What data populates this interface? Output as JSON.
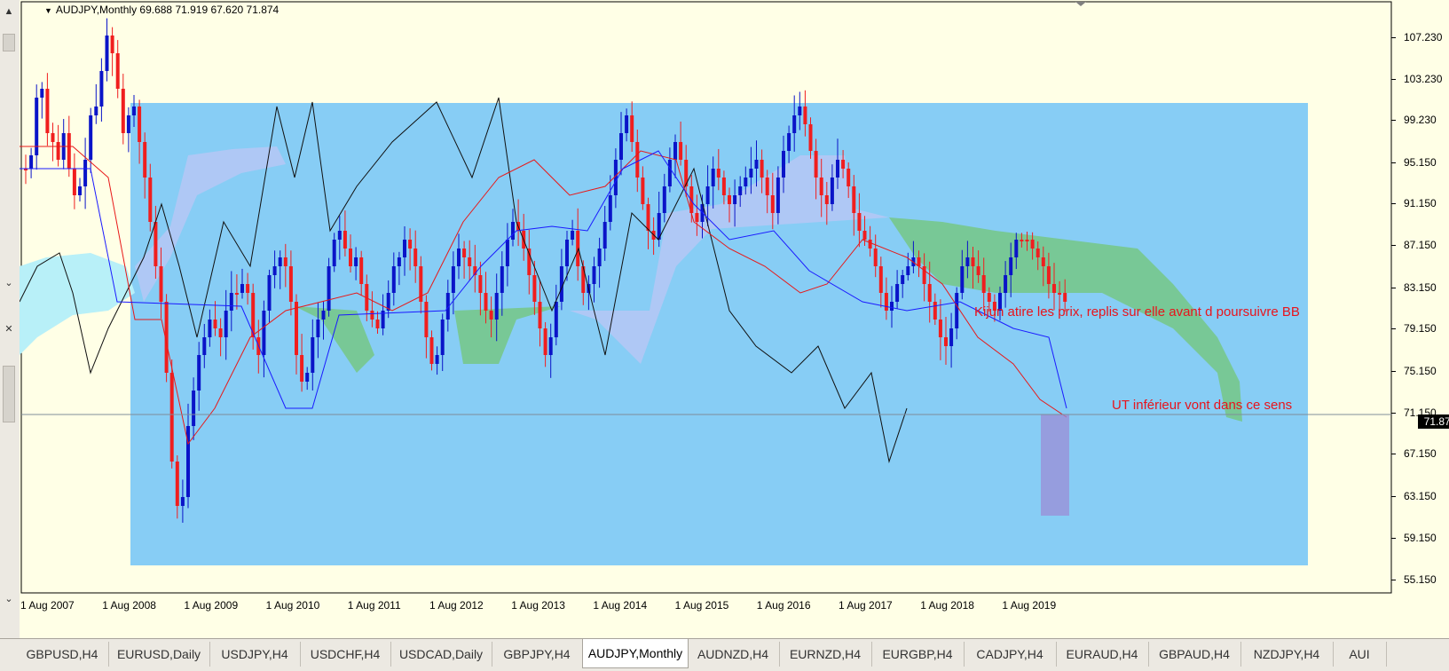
{
  "chart": {
    "symbol_line": "AUDJPY,Monthly  69.688 71.919 67.620 71.874",
    "current_price": "71.874",
    "price_axis": [
      "107.230",
      "103.230",
      "99.230",
      "95.150",
      "91.150",
      "87.150",
      "83.150",
      "79.150",
      "75.150",
      "71.150",
      "67.150",
      "63.150",
      "59.150",
      "55.150"
    ],
    "time_axis": [
      "1 Aug 2007",
      "1 Aug 2008",
      "1 Aug 2009",
      "1 Aug 2010",
      "1 Aug 2011",
      "1 Aug 2012",
      "1 Aug 2013",
      "1 Aug 2014",
      "1 Aug 2015",
      "1 Aug 2016",
      "1 Aug 2017",
      "1 Aug 2018",
      "1 Aug 2019"
    ],
    "annotations": {
      "kijun": "Kijun atire les prix, replis sur elle avant d poursuivre BB",
      "ut": "UT inférieur vont dans ce sens"
    },
    "colors": {
      "bull_candle": "#0a14c8",
      "bear_candle": "#f01e1e",
      "tenkan": "#e81818",
      "kijun": "#1a1aff",
      "chikou": "#101010",
      "background": "#ffffe6",
      "rectangle": "#87cdf5",
      "kumo_bull": "#b4c8f5",
      "kumo_bear": "#78c896"
    }
  },
  "tabs": [
    {
      "label": "GBPUSD,H4",
      "active": false
    },
    {
      "label": "EURUSD,Daily",
      "active": false
    },
    {
      "label": "USDJPY,H4",
      "active": false
    },
    {
      "label": "USDCHF,H4",
      "active": false
    },
    {
      "label": "USDCAD,Daily",
      "active": false
    },
    {
      "label": "GBPJPY,H4",
      "active": false
    },
    {
      "label": "AUDJPY,Monthly",
      "active": true
    },
    {
      "label": "AUDNZD,H4",
      "active": false
    },
    {
      "label": "EURNZD,H4",
      "active": false
    },
    {
      "label": "EURGBP,H4",
      "active": false
    },
    {
      "label": "CADJPY,H4",
      "active": false
    },
    {
      "label": "EURAUD,H4",
      "active": false
    },
    {
      "label": "GBPAUD,H4",
      "active": false
    },
    {
      "label": "NZDJPY,H4",
      "active": false
    },
    {
      "label": "AUI",
      "active": false
    }
  ]
}
